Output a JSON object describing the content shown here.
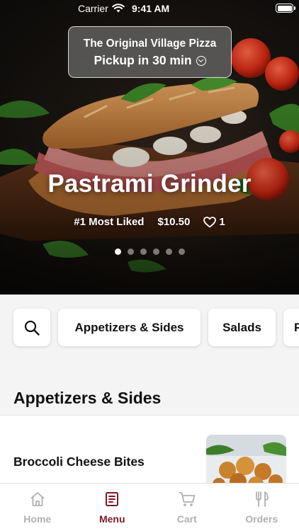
{
  "status_bar": {
    "carrier": "Carrier",
    "time": "9:41 AM"
  },
  "header": {
    "restaurant_name": "The Original Village Pizza",
    "pickup_text": "Pickup in 30 min"
  },
  "hero": {
    "title": "Pastrami Grinder",
    "badge": "#1 Most Liked",
    "price": "$10.50",
    "likes": "1",
    "slide_count": 6,
    "active_slide": 1
  },
  "categories": {
    "search_icon": "search-icon",
    "items": [
      "Appetizers & Sides",
      "Salads",
      "P"
    ]
  },
  "section": {
    "title": "Appetizers & Sides"
  },
  "menu_items": [
    {
      "name": "Broccoli Cheese Bites"
    }
  ],
  "tab_bar": {
    "tabs": [
      {
        "label": "Home",
        "icon": "home-icon",
        "active": false
      },
      {
        "label": "Menu",
        "icon": "menu-icon",
        "active": true
      },
      {
        "label": "Cart",
        "icon": "cart-icon",
        "active": false
      },
      {
        "label": "Orders",
        "icon": "orders-icon",
        "active": false
      }
    ]
  },
  "colors": {
    "accent": "#7a1a2a",
    "inactive_tab": "#b0b0b0",
    "background": "#f4f4f4"
  }
}
